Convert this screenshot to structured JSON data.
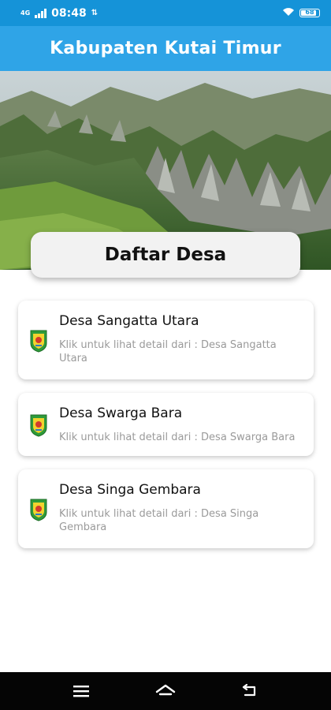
{
  "status_bar": {
    "time": "08:48",
    "network": "4G",
    "battery_level": "68"
  },
  "app_bar": {
    "title": "Kabupaten Kutai Timur"
  },
  "hero": {
    "image_subject": "karst-mountain-landscape"
  },
  "section": {
    "heading": "Daftar Desa"
  },
  "villages": [
    {
      "name": "Desa Sangatta Utara",
      "description": "Klik untuk lihat detail dari : Desa Sangatta Utara"
    },
    {
      "name": "Desa Swarga Bara",
      "description": "Klik untuk lihat detail dari : Desa Swarga Bara"
    },
    {
      "name": "Desa Singa Gembara",
      "description": "Klik untuk lihat detail dari : Desa Singa Gembara"
    }
  ],
  "nav": {
    "icons": [
      "menu-icon",
      "home-icon",
      "back-icon"
    ]
  },
  "colors": {
    "status_bar": "#1593d8",
    "app_bar": "#2fa4e7",
    "card_bg": "#ffffff",
    "heading_card_bg": "#f2f2f2",
    "description_text": "#9a9a9a"
  }
}
